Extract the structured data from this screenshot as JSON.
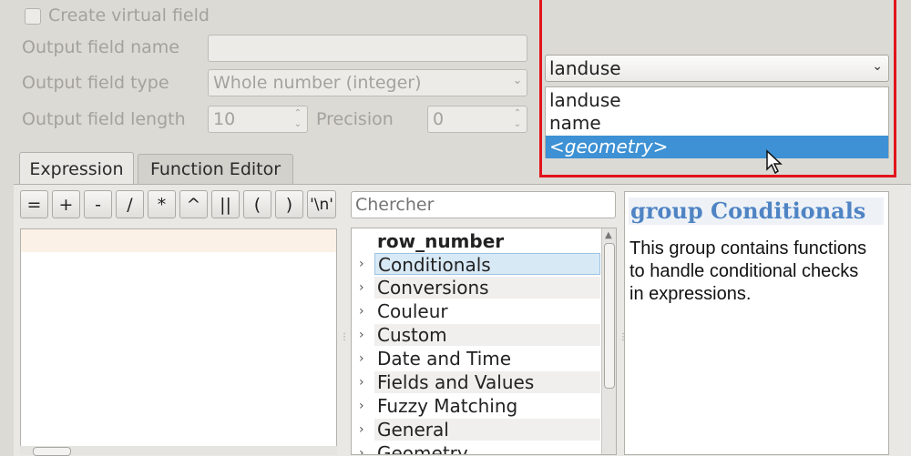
{
  "form": {
    "create_virtual_label": "Create virtual field",
    "output_name_label": "Output field name",
    "output_name_value": "",
    "output_type_label": "Output field type",
    "output_type_value": "Whole number (integer)",
    "output_length_label": "Output field length",
    "output_length_value": "10",
    "precision_label": "Precision",
    "precision_value": "0"
  },
  "field_combo": {
    "selected": "landuse",
    "options": [
      "landuse",
      "name",
      "<geometry>"
    ],
    "highlighted_index": 2
  },
  "tabs": [
    {
      "label": "Expression",
      "active": true
    },
    {
      "label": "Function Editor",
      "active": false
    }
  ],
  "operators": [
    "=",
    "+",
    "-",
    "/",
    "*",
    "^",
    "||",
    "(",
    ")",
    "'\\n'"
  ],
  "search": {
    "placeholder": "Chercher"
  },
  "function_tree": {
    "items": [
      {
        "label": "row_number",
        "bold": true,
        "expandable": false
      },
      {
        "label": "Conditionals",
        "expandable": true,
        "selected": true
      },
      {
        "label": "Conversions",
        "expandable": true
      },
      {
        "label": "Couleur",
        "expandable": true
      },
      {
        "label": "Custom",
        "expandable": true
      },
      {
        "label": "Date and Time",
        "expandable": true
      },
      {
        "label": "Fields and Values",
        "expandable": true
      },
      {
        "label": "Fuzzy Matching",
        "expandable": true
      },
      {
        "label": "General",
        "expandable": true
      },
      {
        "label": "Geometry",
        "expandable": true
      }
    ]
  },
  "help": {
    "title": "group Conditionals",
    "body": "This group contains functions to handle conditional checks in expressions."
  },
  "colors": {
    "highlight": "#3d91d4",
    "callout_border": "#e2141b",
    "help_title": "#4f84c4"
  }
}
